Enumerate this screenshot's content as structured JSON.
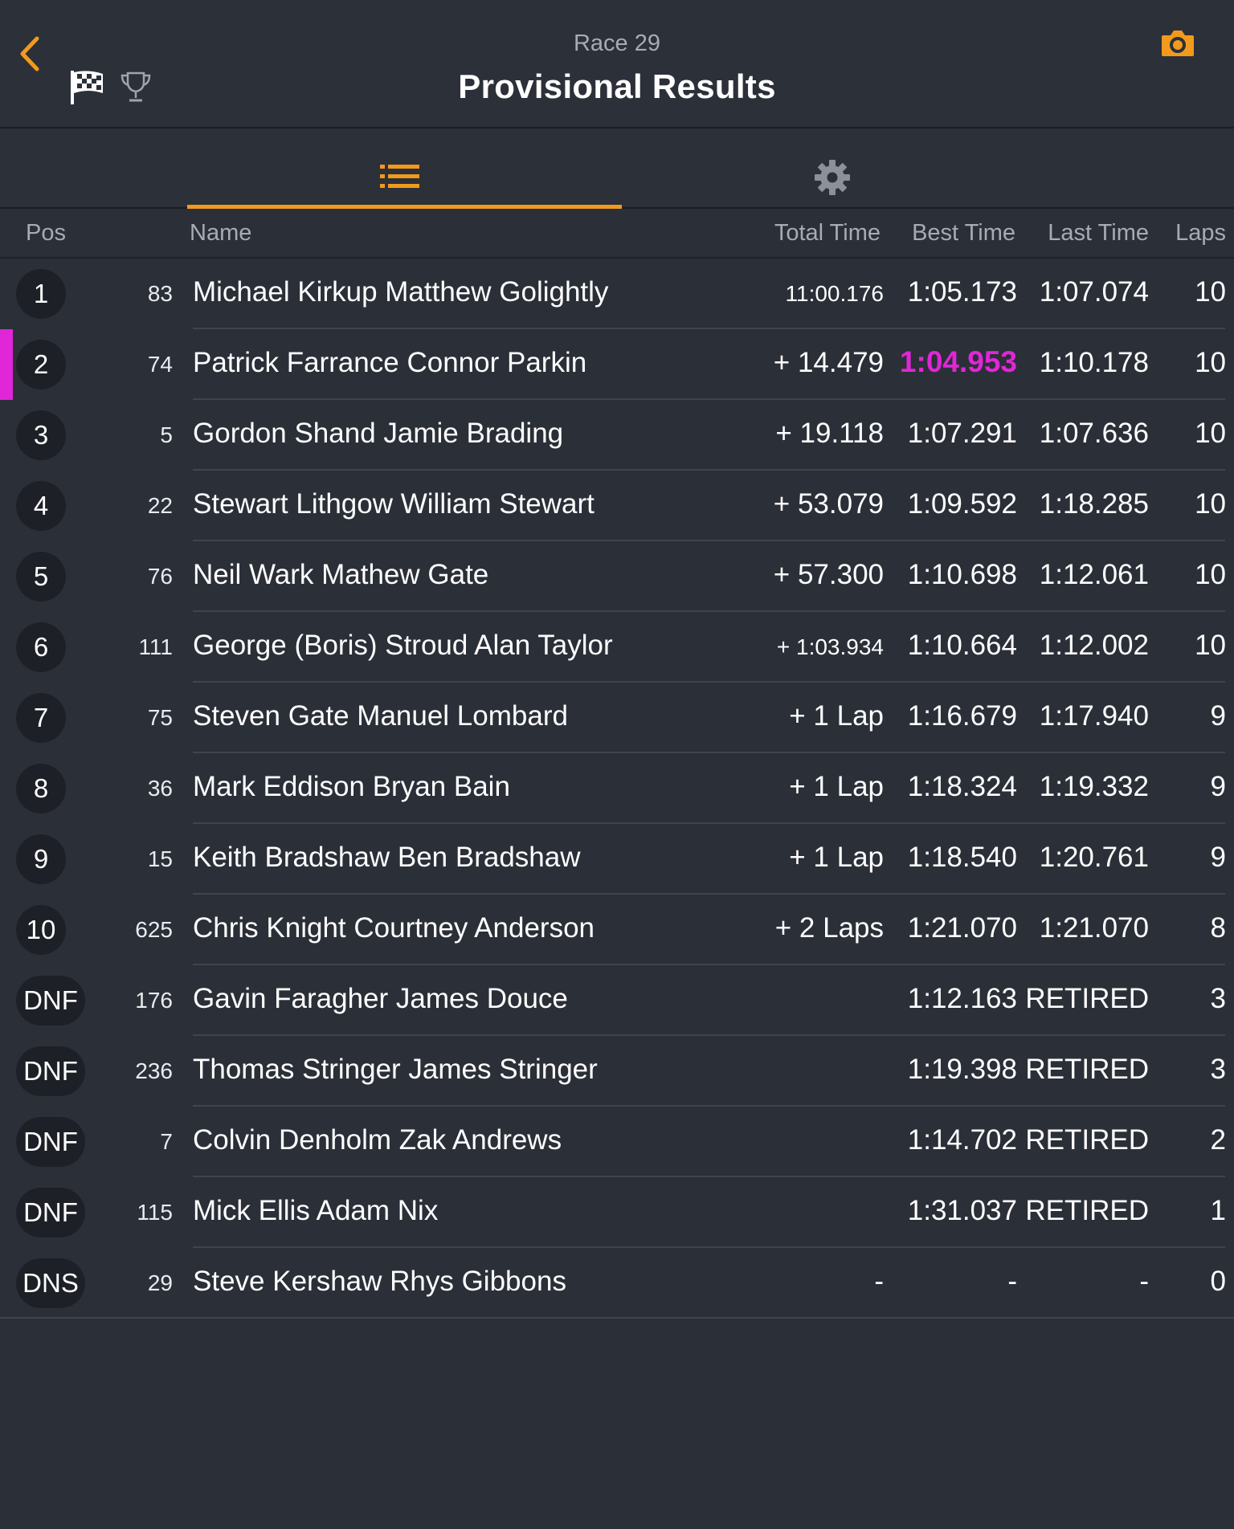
{
  "header": {
    "subtitle": "Race 29",
    "title": "Provisional Results",
    "back_icon": "chevron-left-icon",
    "flag_icon": "checkered-flag-icon",
    "trophy_icon": "trophy-icon",
    "camera_icon": "camera-icon",
    "accent_color": "#f29a1b"
  },
  "tabs": [
    {
      "icon": "list-icon",
      "active": true
    },
    {
      "icon": "gear-icon",
      "active": false
    }
  ],
  "columns": {
    "pos": "Pos",
    "name": "Name",
    "total": "Total Time",
    "best": "Best Time",
    "last": "Last Time",
    "laps": "Laps"
  },
  "fastest_lap_color": "#e026d6",
  "results": [
    {
      "pos": "1",
      "num": "83",
      "name": "Michael Kirkup Matthew Golightly",
      "total": "11:00.176",
      "best": "1:05.173",
      "last": "1:07.074",
      "laps": "10"
    },
    {
      "pos": "2",
      "num": "74",
      "name": "Patrick Farrance Connor Parkin",
      "total": "+ 14.479",
      "best": "1:04.953",
      "last": "1:10.178",
      "laps": "10",
      "fastest": true
    },
    {
      "pos": "3",
      "num": "5",
      "name": "Gordon Shand Jamie Brading",
      "total": "+ 19.118",
      "best": "1:07.291",
      "last": "1:07.636",
      "laps": "10"
    },
    {
      "pos": "4",
      "num": "22",
      "name": "Stewart Lithgow William Stewart",
      "total": "+ 53.079",
      "best": "1:09.592",
      "last": "1:18.285",
      "laps": "10"
    },
    {
      "pos": "5",
      "num": "76",
      "name": "Neil Wark Mathew Gate",
      "total": "+ 57.300",
      "best": "1:10.698",
      "last": "1:12.061",
      "laps": "10"
    },
    {
      "pos": "6",
      "num": "111",
      "name": "George (Boris) Stroud Alan Taylor",
      "total": "+ 1:03.934",
      "best": "1:10.664",
      "last": "1:12.002",
      "laps": "10"
    },
    {
      "pos": "7",
      "num": "75",
      "name": "Steven Gate Manuel Lombard",
      "total": "+ 1 Lap",
      "best": "1:16.679",
      "last": "1:17.940",
      "laps": "9"
    },
    {
      "pos": "8",
      "num": "36",
      "name": "Mark Eddison Bryan Bain",
      "total": "+ 1 Lap",
      "best": "1:18.324",
      "last": "1:19.332",
      "laps": "9"
    },
    {
      "pos": "9",
      "num": "15",
      "name": "Keith Bradshaw Ben Bradshaw",
      "total": "+ 1 Lap",
      "best": "1:18.540",
      "last": "1:20.761",
      "laps": "9"
    },
    {
      "pos": "10",
      "num": "625",
      "name": "Chris Knight Courtney Anderson",
      "total": "+ 2 Laps",
      "best": "1:21.070",
      "last": "1:21.070",
      "laps": "8"
    },
    {
      "pos": "DNF",
      "num": "176",
      "name": "Gavin Faragher James Douce",
      "total": "",
      "best": "1:12.163",
      "last": "RETIRED",
      "laps": "3"
    },
    {
      "pos": "DNF",
      "num": "236",
      "name": "Thomas Stringer James Stringer",
      "total": "",
      "best": "1:19.398",
      "last": "RETIRED",
      "laps": "3"
    },
    {
      "pos": "DNF",
      "num": "7",
      "name": "Colvin Denholm Zak Andrews",
      "total": "",
      "best": "1:14.702",
      "last": "RETIRED",
      "laps": "2"
    },
    {
      "pos": "DNF",
      "num": "115",
      "name": "Mick Ellis Adam Nix",
      "total": "",
      "best": "1:31.037",
      "last": "RETIRED",
      "laps": "1"
    },
    {
      "pos": "DNS",
      "num": "29",
      "name": "Steve Kershaw Rhys Gibbons",
      "total": "-",
      "best": "-",
      "last": "-",
      "laps": "0"
    }
  ]
}
